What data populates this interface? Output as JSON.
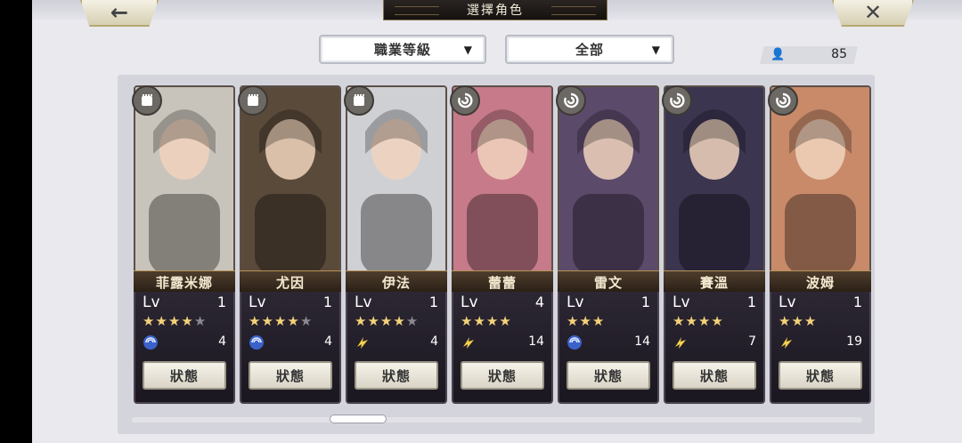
{
  "header": {
    "title": "選擇角色",
    "back_icon": "←",
    "close_icon": "✕"
  },
  "filters": {
    "sort_label": "職業等級",
    "filter_label": "全部",
    "arrow": "▼"
  },
  "roster_count": {
    "icon": "👤",
    "value": "85"
  },
  "characters": [
    {
      "name": "菲露米娜",
      "lv_label": "Lv",
      "level": "1",
      "stars": 4,
      "max_stars": 5,
      "element": "wind",
      "power": "4",
      "status": "狀態",
      "class_icon": "fist",
      "color": "#c9c4bb"
    },
    {
      "name": "尤因",
      "lv_label": "Lv",
      "level": "1",
      "stars": 4,
      "max_stars": 5,
      "element": "wind",
      "power": "4",
      "status": "狀態",
      "class_icon": "fist",
      "color": "#5a4a3a"
    },
    {
      "name": "伊法",
      "lv_label": "Lv",
      "level": "1",
      "stars": 4,
      "max_stars": 5,
      "element": "lightning",
      "power": "4",
      "status": "狀態",
      "class_icon": "fist",
      "color": "#cfd0d4"
    },
    {
      "name": "蕾蕾",
      "lv_label": "Lv",
      "level": "4",
      "stars": 4,
      "max_stars": 4,
      "element": "lightning",
      "power": "14",
      "status": "狀態",
      "class_icon": "spiral",
      "color": "#c77a8a"
    },
    {
      "name": "雷文",
      "lv_label": "Lv",
      "level": "1",
      "stars": 3,
      "max_stars": 3,
      "element": "wind",
      "power": "14",
      "status": "狀態",
      "class_icon": "spiral",
      "color": "#5b4a6a"
    },
    {
      "name": "賽溫",
      "lv_label": "Lv",
      "level": "1",
      "stars": 4,
      "max_stars": 4,
      "element": "lightning",
      "power": "7",
      "status": "狀態",
      "class_icon": "spiral",
      "color": "#3b3550"
    },
    {
      "name": "波姆",
      "lv_label": "Lv",
      "level": "1",
      "stars": 3,
      "max_stars": 3,
      "element": "lightning",
      "power": "19",
      "status": "狀態",
      "class_icon": "spiral",
      "color": "#c98a6a"
    }
  ]
}
